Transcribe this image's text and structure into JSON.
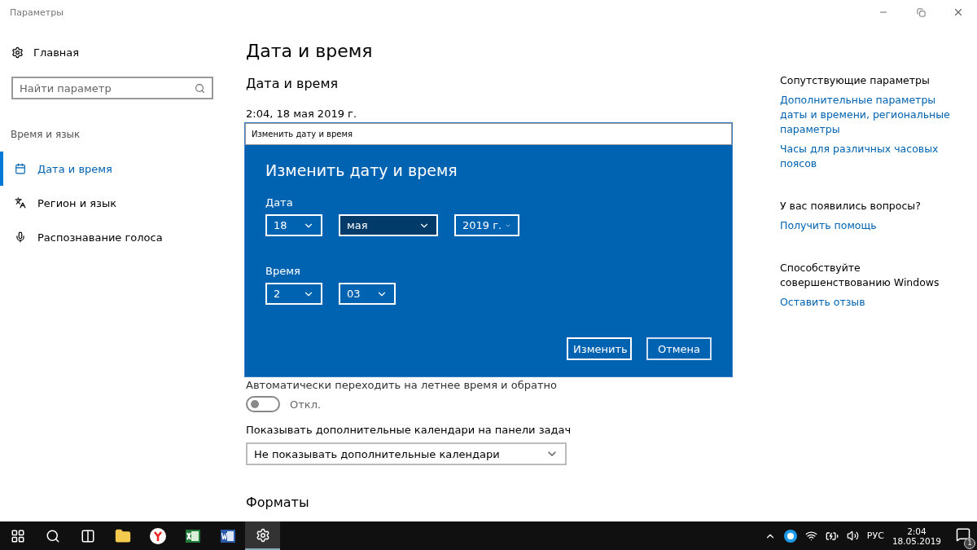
{
  "window": {
    "title": "Параметры"
  },
  "sidebar": {
    "home": "Главная",
    "search": {
      "placeholder": "Найти параметр"
    },
    "section": "Время и язык",
    "items": [
      {
        "label": "Дата и время",
        "selected": true
      },
      {
        "label": "Регион и язык",
        "selected": false
      },
      {
        "label": "Распознавание голоса",
        "selected": false
      }
    ]
  },
  "main": {
    "title": "Дата и время",
    "section_title": "Дата и время",
    "current": "2:04, 18 мая 2019 г.",
    "dst_label": "Автоматически переходить на летнее время и обратно",
    "dst_toggle": {
      "on": false,
      "label": "Откл."
    },
    "calendars_label": "Показывать дополнительные календари на панели задач",
    "calendars_value": "Не показывать дополнительные календари",
    "formats_title": "Форматы"
  },
  "dialog": {
    "window_title": "Изменить дату и время",
    "title": "Изменить дату и время",
    "groups": [
      {
        "label": "Дата",
        "fields": [
          "18",
          "мая",
          "2019 г."
        ]
      },
      {
        "label": "Время",
        "fields": [
          "2",
          "03"
        ]
      }
    ],
    "buttons": [
      {
        "label": "Изменить",
        "focused": true
      },
      {
        "label": "Отмена",
        "focused": false
      }
    ]
  },
  "related": [
    {
      "heading": "Сопутствующие параметры",
      "links": [
        "Дополнительные параметры даты и времени, региональные параметры",
        "Часы для различных часовых поясов"
      ]
    },
    {
      "heading": "У вас появились вопросы?",
      "links": [
        "Получить помощь"
      ]
    },
    {
      "heading": "Способствуйте совершенствованию Windows",
      "links": [
        "Оставить отзыв"
      ]
    }
  ],
  "taskbar": {
    "apps": [
      {
        "active": false
      },
      {
        "active": false
      },
      {
        "active": false
      },
      {
        "active": false
      },
      {
        "active": false
      },
      {
        "active": false
      },
      {
        "active": false
      },
      {
        "active": true
      }
    ],
    "language": "РУС",
    "time": "2:04",
    "date": "18.05.2019",
    "notifications": "1"
  }
}
